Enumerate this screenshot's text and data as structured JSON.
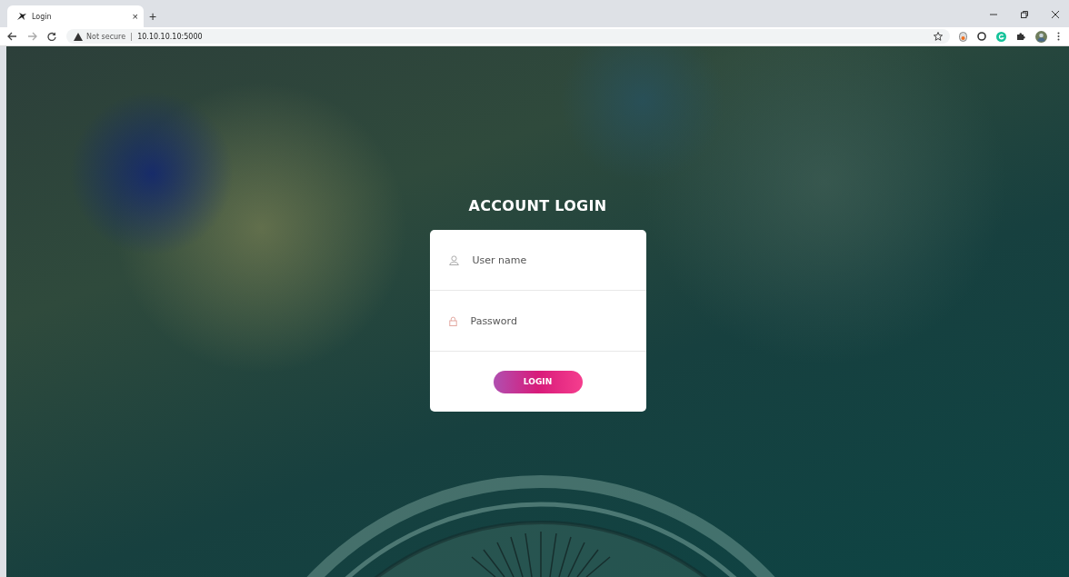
{
  "browser": {
    "tab": {
      "title": "Login",
      "close": "×"
    },
    "new_tab": "+",
    "address": {
      "security": "Not secure",
      "url": "10.10.10.10:5000"
    }
  },
  "login": {
    "heading": "ACCOUNT LOGIN",
    "username": {
      "placeholder": "User name"
    },
    "password": {
      "placeholder": "Password"
    },
    "button": "LOGIN"
  }
}
